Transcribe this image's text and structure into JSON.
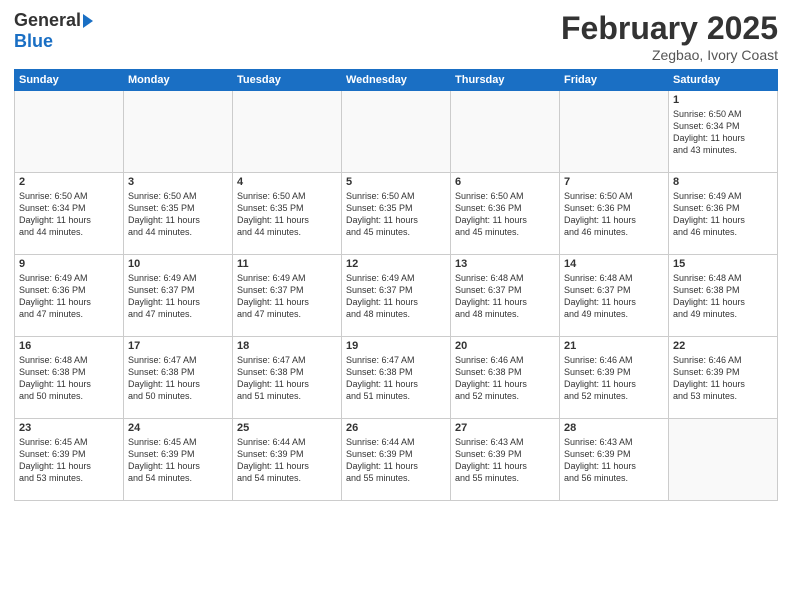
{
  "header": {
    "logo_general": "General",
    "logo_blue": "Blue",
    "month_title": "February 2025",
    "subtitle": "Zegbao, Ivory Coast"
  },
  "calendar": {
    "days_of_week": [
      "Sunday",
      "Monday",
      "Tuesday",
      "Wednesday",
      "Thursday",
      "Friday",
      "Saturday"
    ],
    "weeks": [
      [
        {
          "day": "",
          "info": ""
        },
        {
          "day": "",
          "info": ""
        },
        {
          "day": "",
          "info": ""
        },
        {
          "day": "",
          "info": ""
        },
        {
          "day": "",
          "info": ""
        },
        {
          "day": "",
          "info": ""
        },
        {
          "day": "1",
          "info": "Sunrise: 6:50 AM\nSunset: 6:34 PM\nDaylight: 11 hours\nand 43 minutes."
        }
      ],
      [
        {
          "day": "2",
          "info": "Sunrise: 6:50 AM\nSunset: 6:34 PM\nDaylight: 11 hours\nand 44 minutes."
        },
        {
          "day": "3",
          "info": "Sunrise: 6:50 AM\nSunset: 6:35 PM\nDaylight: 11 hours\nand 44 minutes."
        },
        {
          "day": "4",
          "info": "Sunrise: 6:50 AM\nSunset: 6:35 PM\nDaylight: 11 hours\nand 44 minutes."
        },
        {
          "day": "5",
          "info": "Sunrise: 6:50 AM\nSunset: 6:35 PM\nDaylight: 11 hours\nand 45 minutes."
        },
        {
          "day": "6",
          "info": "Sunrise: 6:50 AM\nSunset: 6:36 PM\nDaylight: 11 hours\nand 45 minutes."
        },
        {
          "day": "7",
          "info": "Sunrise: 6:50 AM\nSunset: 6:36 PM\nDaylight: 11 hours\nand 46 minutes."
        },
        {
          "day": "8",
          "info": "Sunrise: 6:49 AM\nSunset: 6:36 PM\nDaylight: 11 hours\nand 46 minutes."
        }
      ],
      [
        {
          "day": "9",
          "info": "Sunrise: 6:49 AM\nSunset: 6:36 PM\nDaylight: 11 hours\nand 47 minutes."
        },
        {
          "day": "10",
          "info": "Sunrise: 6:49 AM\nSunset: 6:37 PM\nDaylight: 11 hours\nand 47 minutes."
        },
        {
          "day": "11",
          "info": "Sunrise: 6:49 AM\nSunset: 6:37 PM\nDaylight: 11 hours\nand 47 minutes."
        },
        {
          "day": "12",
          "info": "Sunrise: 6:49 AM\nSunset: 6:37 PM\nDaylight: 11 hours\nand 48 minutes."
        },
        {
          "day": "13",
          "info": "Sunrise: 6:48 AM\nSunset: 6:37 PM\nDaylight: 11 hours\nand 48 minutes."
        },
        {
          "day": "14",
          "info": "Sunrise: 6:48 AM\nSunset: 6:37 PM\nDaylight: 11 hours\nand 49 minutes."
        },
        {
          "day": "15",
          "info": "Sunrise: 6:48 AM\nSunset: 6:38 PM\nDaylight: 11 hours\nand 49 minutes."
        }
      ],
      [
        {
          "day": "16",
          "info": "Sunrise: 6:48 AM\nSunset: 6:38 PM\nDaylight: 11 hours\nand 50 minutes."
        },
        {
          "day": "17",
          "info": "Sunrise: 6:47 AM\nSunset: 6:38 PM\nDaylight: 11 hours\nand 50 minutes."
        },
        {
          "day": "18",
          "info": "Sunrise: 6:47 AM\nSunset: 6:38 PM\nDaylight: 11 hours\nand 51 minutes."
        },
        {
          "day": "19",
          "info": "Sunrise: 6:47 AM\nSunset: 6:38 PM\nDaylight: 11 hours\nand 51 minutes."
        },
        {
          "day": "20",
          "info": "Sunrise: 6:46 AM\nSunset: 6:38 PM\nDaylight: 11 hours\nand 52 minutes."
        },
        {
          "day": "21",
          "info": "Sunrise: 6:46 AM\nSunset: 6:39 PM\nDaylight: 11 hours\nand 52 minutes."
        },
        {
          "day": "22",
          "info": "Sunrise: 6:46 AM\nSunset: 6:39 PM\nDaylight: 11 hours\nand 53 minutes."
        }
      ],
      [
        {
          "day": "23",
          "info": "Sunrise: 6:45 AM\nSunset: 6:39 PM\nDaylight: 11 hours\nand 53 minutes."
        },
        {
          "day": "24",
          "info": "Sunrise: 6:45 AM\nSunset: 6:39 PM\nDaylight: 11 hours\nand 54 minutes."
        },
        {
          "day": "25",
          "info": "Sunrise: 6:44 AM\nSunset: 6:39 PM\nDaylight: 11 hours\nand 54 minutes."
        },
        {
          "day": "26",
          "info": "Sunrise: 6:44 AM\nSunset: 6:39 PM\nDaylight: 11 hours\nand 55 minutes."
        },
        {
          "day": "27",
          "info": "Sunrise: 6:43 AM\nSunset: 6:39 PM\nDaylight: 11 hours\nand 55 minutes."
        },
        {
          "day": "28",
          "info": "Sunrise: 6:43 AM\nSunset: 6:39 PM\nDaylight: 11 hours\nand 56 minutes."
        },
        {
          "day": "",
          "info": ""
        }
      ]
    ]
  }
}
